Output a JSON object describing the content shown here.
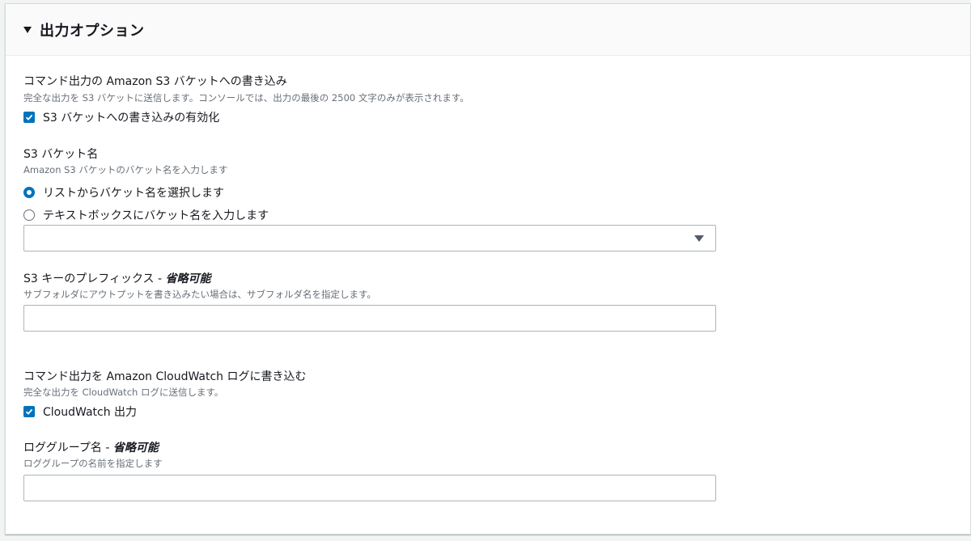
{
  "panel": {
    "title": "出力オプション"
  },
  "s3_output": {
    "label": "コマンド出力の Amazon S3 バケットへの書き込み",
    "description": "完全な出力を S3 バケットに送信します。コンソールでは、出力の最後の 2500 文字のみが表示されます。",
    "enable_label": "S3 バケットへの書き込みの有効化",
    "enabled": true
  },
  "bucket_name": {
    "label": "S3 バケット名",
    "description": "Amazon S3 バケットのバケット名を入力します",
    "option_list": "リストからバケット名を選択します",
    "option_text": "テキストボックスにバケット名を入力します",
    "selected_option": "list",
    "select_value": ""
  },
  "key_prefix": {
    "label": "S3 キーのプレフィックス - ",
    "optional": "省略可能",
    "description": "サブフォルダにアウトプットを書き込みたい場合は、サブフォルダ名を指定します。",
    "value": ""
  },
  "cloudwatch": {
    "label": "コマンド出力を Amazon CloudWatch ログに書き込む",
    "description": "完全な出力を CloudWatch ログに送信します。",
    "enable_label": "CloudWatch 出力",
    "enabled": true
  },
  "log_group": {
    "label": "ロググループ名 - ",
    "optional": "省略可能",
    "description": "ロググループの名前を指定します",
    "value": ""
  },
  "colors": {
    "accent": "#0073bb",
    "description_text": "#687078",
    "border": "#aab7b8"
  }
}
